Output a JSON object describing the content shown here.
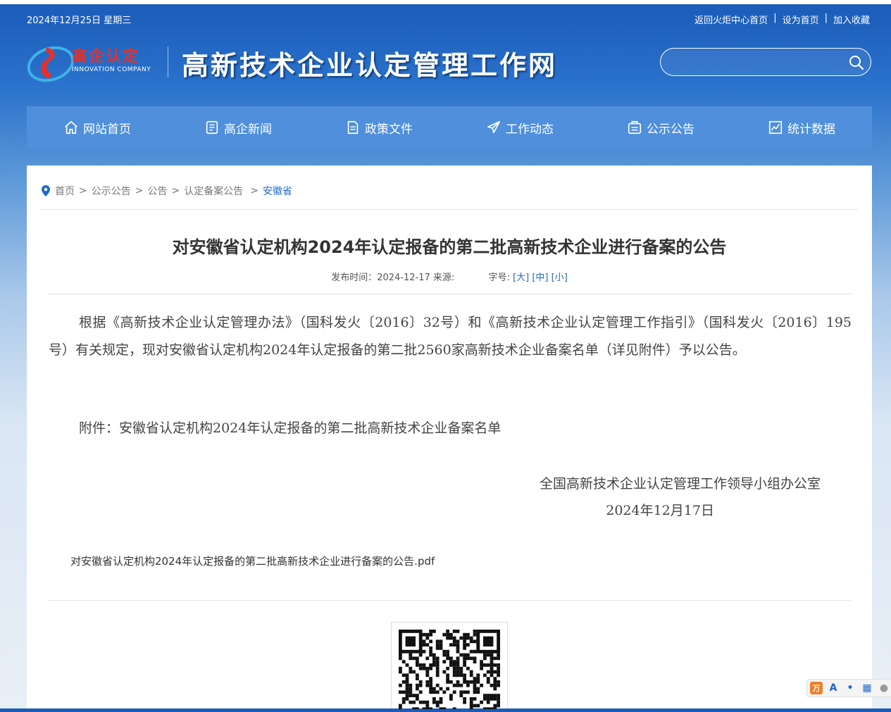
{
  "header": {
    "date": "2024年12月25日 星期三",
    "links": [
      "返回火炬中心首页",
      "设为首页",
      "加入收藏"
    ],
    "link_separator": "|",
    "logo_cn": "高企认定",
    "logo_en": "INNOVATION COMPANY",
    "site_title": "高新技术企业认定管理工作网",
    "search_placeholder": ""
  },
  "nav": [
    {
      "label": "网站首页",
      "icon": "home-icon"
    },
    {
      "label": "高企新闻",
      "icon": "news-icon"
    },
    {
      "label": "政策文件",
      "icon": "document-icon"
    },
    {
      "label": "工作动态",
      "icon": "paper-plane-icon"
    },
    {
      "label": "公示公告",
      "icon": "announcement-icon"
    },
    {
      "label": "统计数据",
      "icon": "chart-icon"
    }
  ],
  "breadcrumb": {
    "items": [
      "首页",
      "公示公告",
      "公告",
      "认定备案公告"
    ],
    "current": "安徽省",
    "separator": ">"
  },
  "article": {
    "title": "对安徽省认定机构2024年认定报备的第二批高新技术企业进行备案的公告",
    "publish_label": "发布时间：2024-12-17 来源:",
    "font_size_label": "字号:",
    "font_sizes": [
      "[大]",
      "[中]",
      "[小]"
    ],
    "paragraph": "根据《高新技术企业认定管理办法》（国科发火〔2016〕32号）和《高新技术企业认定管理工作指引》（国科发火〔2016〕195号）有关规定，现对安徽省认定机构2024年认定报备的第二批2560家高新技术企业备案名单（详见附件）予以公告。",
    "attachment_text": "附件：安徽省认定机构2024年认定报备的第二批高新技术企业备案名单",
    "signature_org": "全国高新技术企业认定管理工作领导小组办公室",
    "signature_date": "2024年12月17日",
    "pdf_link": "对安徽省认定机构2024年认定报备的第二批高新技术企业进行备案的公告.pdf"
  },
  "colors": {
    "nav_bg": "#4f8fdc",
    "link_blue": "#1f68c9",
    "logo_red": "#e3312b"
  }
}
